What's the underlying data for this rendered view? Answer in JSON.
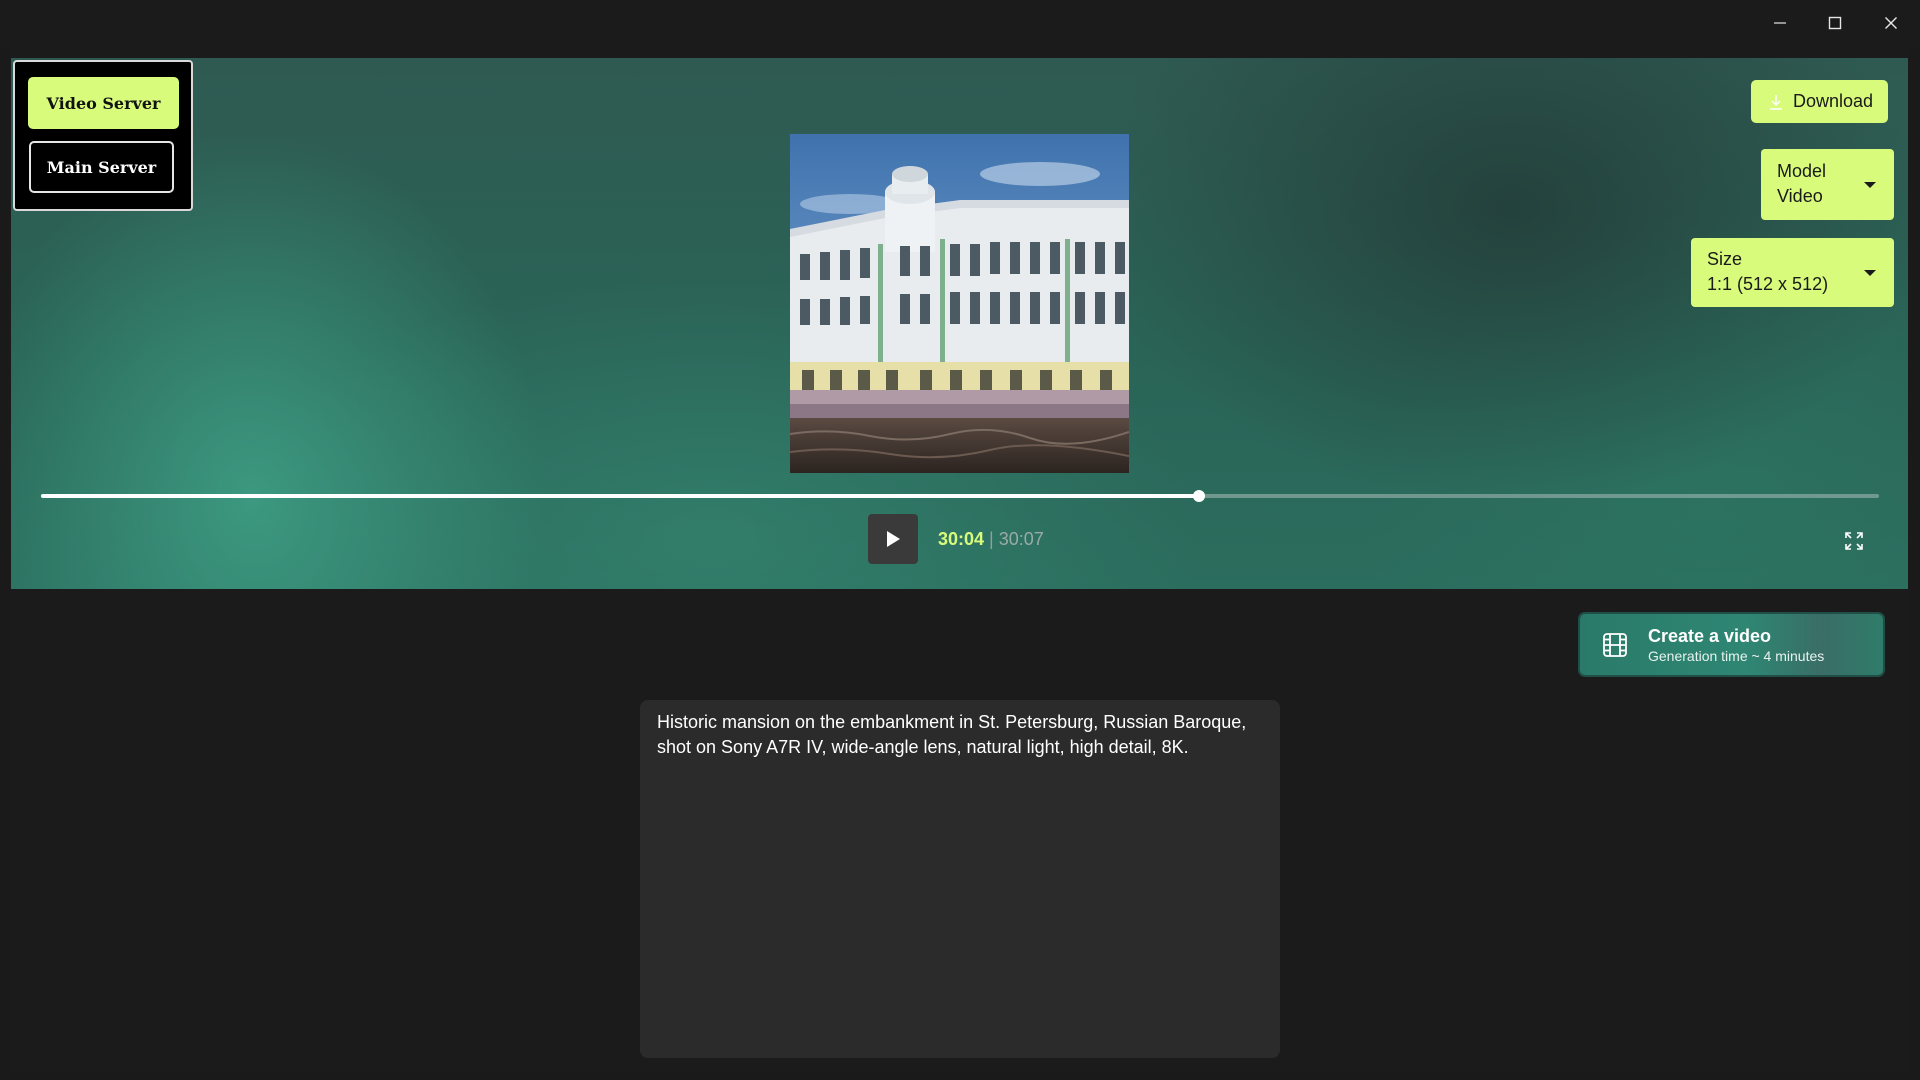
{
  "window": {
    "minimize_icon": "minimize-icon",
    "maximize_icon": "maximize-icon",
    "close_icon": "close-icon"
  },
  "server": {
    "video_label": "Video Server",
    "main_label": "Main Server",
    "active": "Video Server"
  },
  "toolbar": {
    "download_label": "Download",
    "download_icon": "download-icon"
  },
  "model_dropdown": {
    "label": "Model",
    "value": "Video"
  },
  "size_dropdown": {
    "label": "Size",
    "value": "1:1 (512 x 512)"
  },
  "player": {
    "current_time": "30:04",
    "separator": "|",
    "total_time": "30:07",
    "progress": 0.63,
    "play_icon": "play-icon",
    "fullscreen_icon": "fullscreen-icon"
  },
  "create": {
    "title": "Create a video",
    "subtitle": "Generation time ~ 4 minutes",
    "icon": "film-icon"
  },
  "prompt": {
    "text": "Historic mansion on the embankment in St. Petersburg, Russian Baroque, shot on Sony A7R IV, wide-angle lens, natural light, high detail, 8K."
  },
  "colors": {
    "accent": "#d8fb7c",
    "teal": "#2b7a69",
    "background": "#1a1a1a"
  }
}
